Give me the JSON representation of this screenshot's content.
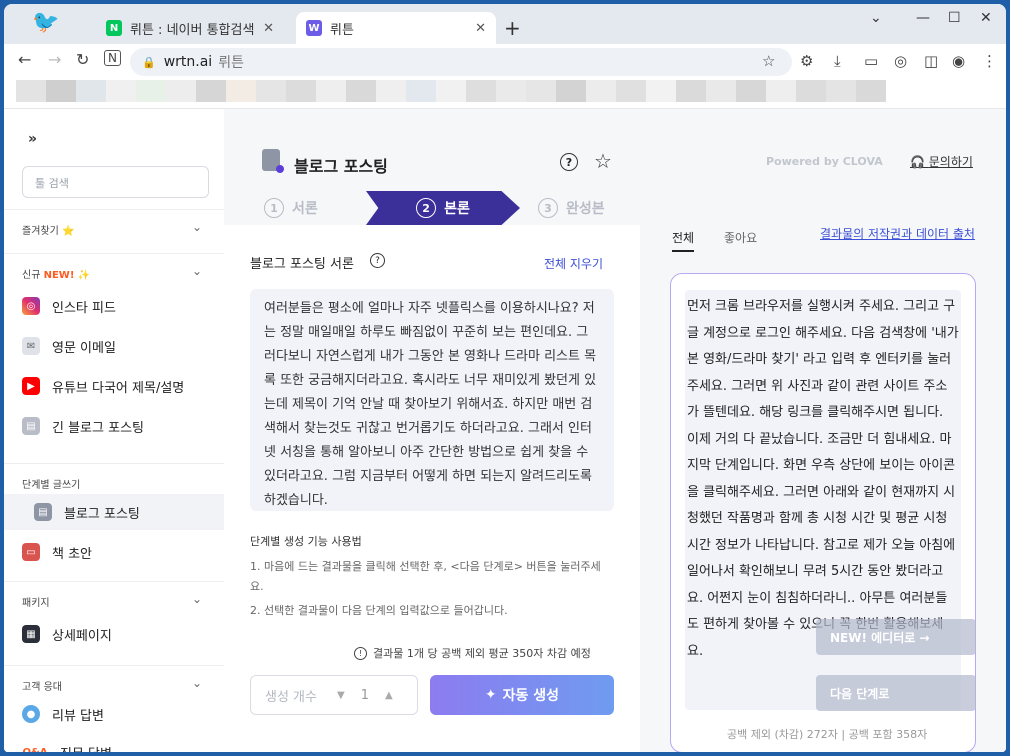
{
  "browser": {
    "tabs": [
      {
        "label": "뤼튼 : 네이버 통합검색",
        "favicon": "N",
        "active": false
      },
      {
        "label": "뤼튼",
        "favicon": "W",
        "active": true
      }
    ],
    "new_tab": "+",
    "url": "wrtn.ai",
    "site_name": "뤼튼"
  },
  "sidebar": {
    "collapse_icon": "»",
    "search_placeholder": "툴 검색",
    "favorites": "즐겨찾기 ⭐",
    "new_section": {
      "prefix": "신규",
      "badge": "NEW!",
      "sparkle": "✨"
    },
    "new_items": [
      "인스타 피드",
      "영문 이메일",
      "유튜브 다국어 제목/설명",
      "긴 블로그 포스팅"
    ],
    "step_section": "단계별 글쓰기",
    "step_items": [
      "블로그 포스팅",
      "책 초안"
    ],
    "package_section": "패키지",
    "package_items": [
      "상세페이지"
    ],
    "customer_section": "고객 응대",
    "customer_items": [
      "리뷰 답변",
      "직무 답변"
    ],
    "qa_badge": "Q&A"
  },
  "header": {
    "title": "블로그 포스팅",
    "help": "?",
    "star": "☆",
    "powered": "Powered by CLOVA",
    "inquiry": "문의하기"
  },
  "steps": [
    {
      "num": "1",
      "label": "서론"
    },
    {
      "num": "2",
      "label": "본론"
    },
    {
      "num": "3",
      "label": "완성본"
    }
  ],
  "left_panel": {
    "label": "블로그 포스팅 서론",
    "clear_all": "전체 지우기",
    "intro_text": "여러분들은 평소에 얼마나 자주 넷플릭스를 이용하시나요? 저는 정말 매일매일 하루도 빠짐없이 꾸준히 보는 편인데요. 그러다보니 자연스럽게 내가 그동안 본 영화나 드라마 리스트 목록 또한 궁금해지더라고요. 혹시라도 너무 재미있게 봤던게 있는데 제목이 기억 안날 때 찾아보기 위해서죠. 하지만 매번 검색해서 찾는것도 귀찮고 번거롭기도 하더라고요. 그래서 인터넷 서칭을 통해 알아보니 아주 간단한 방법으로 쉽게 찾을 수 있더라고요. 그럼 지금부터 어떻게 하면 되는지 알려드리도록 하겠습니다.",
    "guide_title": "단계별 생성 기능 사용법",
    "guide_1": "1. 마음에 드는 결과물을 클릭해 선택한 후, <다음 단계로> 버튼을 눌러주세요.",
    "guide_2": "2. 선택한 결과물이 다음 단계의 입력값으로 들어갑니다.",
    "estimate": "결과물 1개 당 공백 제외 평균 350자 차감 예정",
    "count_label": "생성 개수",
    "count_value": "1",
    "generate": "자동 생성"
  },
  "right_panel": {
    "tab_all": "전체",
    "tab_like": "좋아요",
    "copyright": "결과물의 저작권과 데이터 출처",
    "result_text": "먼저 크롬 브라우저를 실행시켜 주세요. 그리고 구글 계정으로 로그인 해주세요. 다음 검색창에 '내가 본 영화/드라마 찾기' 라고 입력 후 엔터키를 눌러주세요. 그러면 위 사진과 같이 관련 사이트 주소가 뜰텐데요. 해당 링크를 클릭해주시면 됩니다. 이제 거의 다 끝났습니다. 조금만 더 힘내세요. 마지막 단계입니다. 화면 우측 상단에 보이는 아이콘을 클릭해주세요. 그러면 아래와 같이 현재까지 시청했던 작품명과 함께 총 시청 시간 및 평균 시청 시간 정보가 나타납니다. 참고로 제가 오늘 아침에 일어나서 확인해보니 무려 5시간 동안 봤더라고요. 어쩐지 눈이 침침하더라니.. 아무튼 여러분들도 편하게 찾아볼 수 있으니 꼭 한번 활용해보세요.",
    "footer": "공백 제외 (차감) 272자 | 공백 포함 358자",
    "overlay_editor": "NEW! 에디터로 →",
    "overlay_next": "다음 단계로"
  },
  "colors": {
    "accent": "#3b2f9a",
    "link": "#3c4fd6",
    "result_border": "#b7a8f2",
    "new_badge": "#ff5a1f"
  }
}
